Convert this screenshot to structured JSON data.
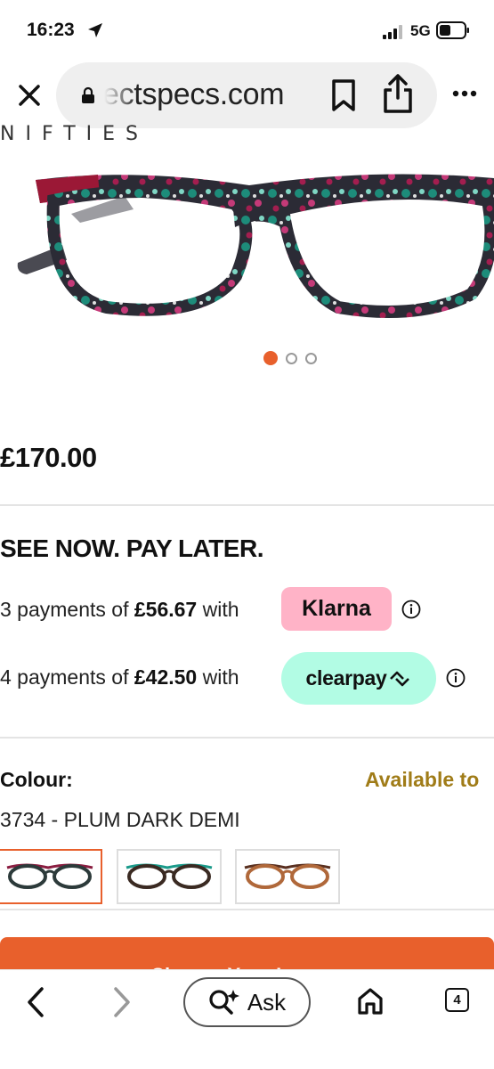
{
  "status_bar": {
    "time": "16:23",
    "network": "5G",
    "icons": [
      "location-arrow-icon",
      "signal-icon",
      "battery-icon"
    ]
  },
  "browser": {
    "url": "ectspecs.com",
    "icons": [
      "close-icon",
      "lock-icon",
      "bookmark-icon",
      "share-icon",
      "more-icon"
    ]
  },
  "product": {
    "brand_strip": "NIFTIES",
    "image_count": 3,
    "active_image": 1,
    "price": "£170.00"
  },
  "bnpl": {
    "title": "SEE NOW. PAY LATER.",
    "klarna": {
      "prefix": "3 payments of ",
      "amount": "£56.67",
      "suffix": " with",
      "badge": "Klarna"
    },
    "clearpay": {
      "prefix": "4 payments of ",
      "amount": "£42.50",
      "suffix": " with",
      "badge": "clearpay"
    }
  },
  "colour": {
    "label": "Colour:",
    "availability": "Available to",
    "selected_name": "3734 - PLUM DARK DEMI",
    "swatches": [
      "plum-dark-demi",
      "teal-demi",
      "brown-demi"
    ],
    "selected_index": 0
  },
  "cta": {
    "label": "Choose Your Lenses"
  },
  "bottom_bar": {
    "ask_label": "Ask",
    "tab_count": "4"
  },
  "colors": {
    "accent": "#e8602c",
    "klarna_pink": "#ffb3c7",
    "clearpay_mint": "#b2fce4",
    "availability_gold": "#a07c18"
  }
}
